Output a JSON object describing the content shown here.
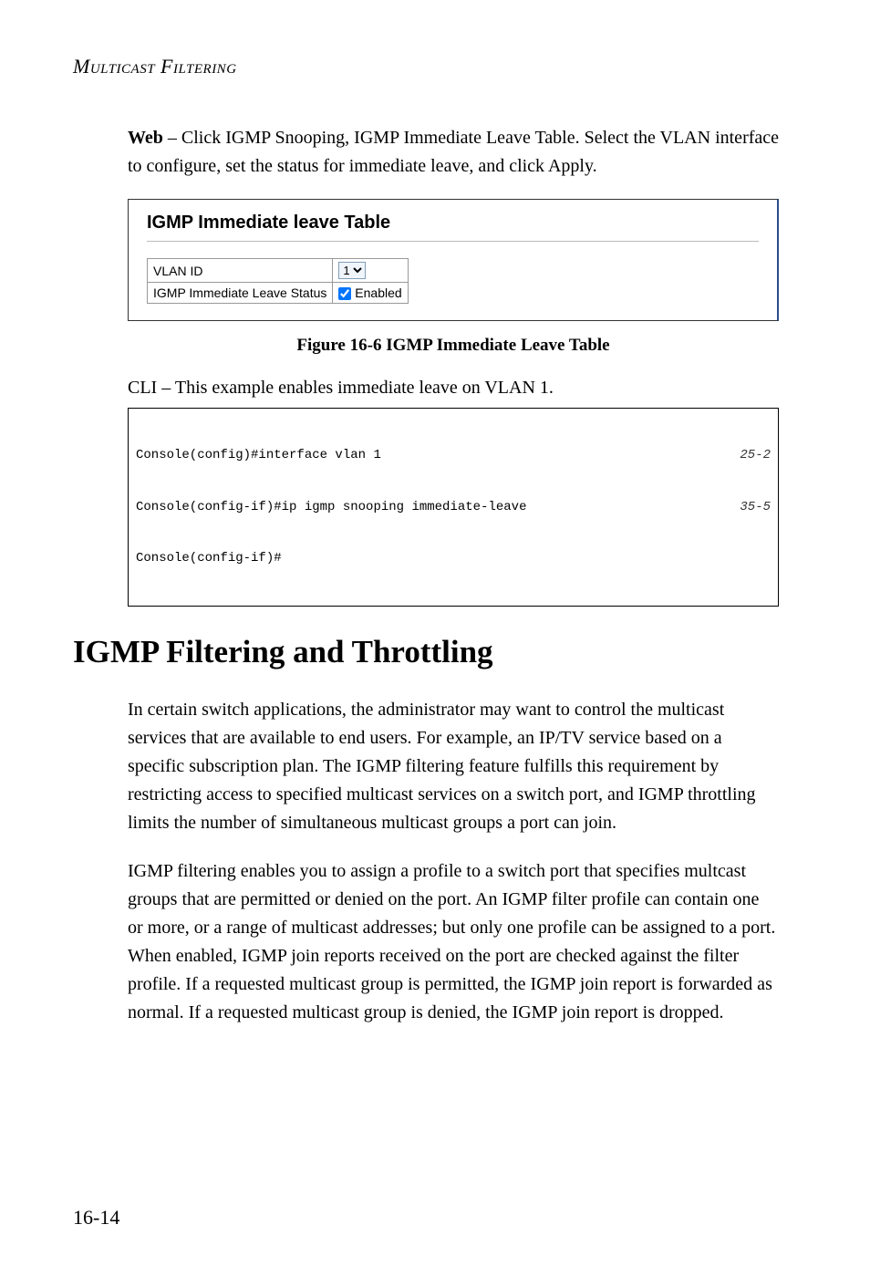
{
  "header": "Multicast Filtering",
  "intro": {
    "web_label": "Web",
    "web_text": " – Click IGMP Snooping, IGMP Immediate Leave Table. Select the VLAN interface to configure, set the status for immediate leave, and click Apply."
  },
  "ui_panel": {
    "title": "IGMP Immediate leave Table",
    "row1_label": "VLAN ID",
    "row1_value": "1",
    "row2_label": "IGMP Immediate Leave Status",
    "row2_suffix": "Enabled"
  },
  "figure_caption": "Figure 16-6  IGMP Immediate Leave Table",
  "cli_intro": "CLI – This example enables immediate leave on VLAN 1.",
  "code": {
    "line1": "Console(config)#interface vlan 1",
    "ref1": "25-2",
    "line2": "Console(config-if)#ip igmp snooping immediate-leave",
    "ref2": "35-5",
    "line3": "Console(config-if)#"
  },
  "section_title": "IGMP Filtering and Throttling",
  "section_para1": "In certain switch applications, the administrator may want to control the multicast services that are available to end users. For example, an IP/TV service based on a specific subscription plan. The IGMP filtering feature fulfills this requirement by restricting access to specified multicast services on a switch port, and IGMP throttling limits the number of simultaneous multicast groups a port can join.",
  "section_para2": "IGMP filtering enables you to assign a profile to a switch port that specifies multcast groups that are permitted or denied on the port. An IGMP filter profile can contain one or more, or a range of multicast addresses; but only one profile can be assigned to a port. When enabled, IGMP join reports received on the port are checked against the filter profile. If a requested multicast group is permitted, the IGMP join report is forwarded as normal. If a requested multicast group is denied, the IGMP join report is dropped.",
  "page_number": "16-14"
}
